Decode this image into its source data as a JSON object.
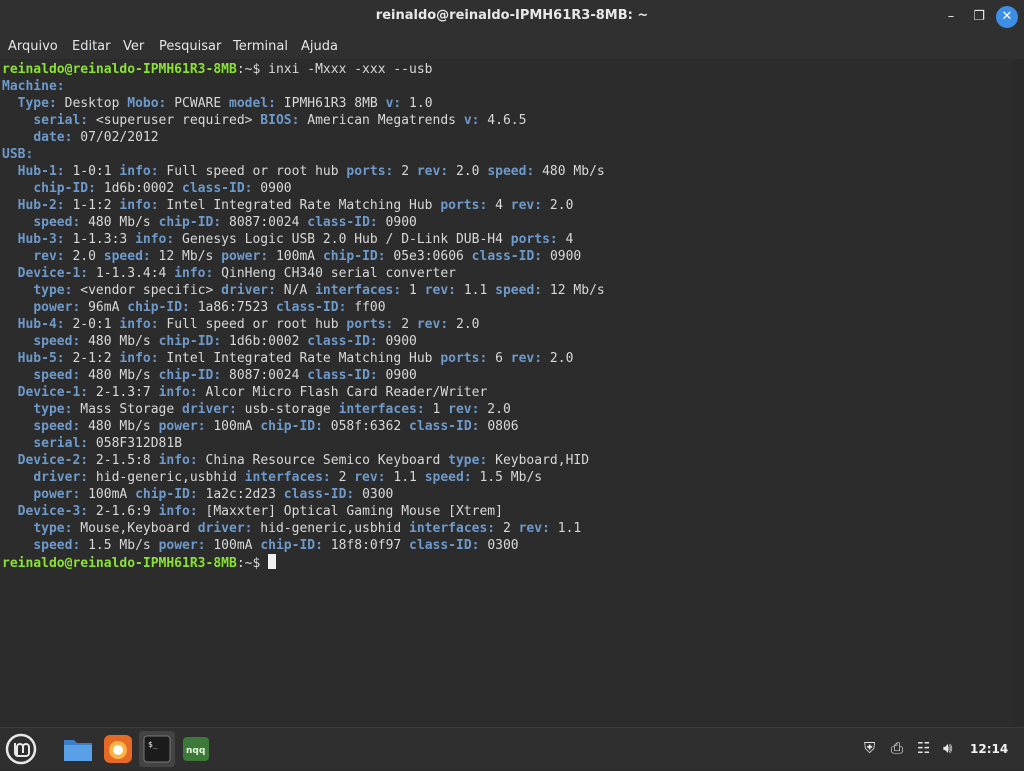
{
  "window": {
    "title": "reinaldo@reinaldo-IPMH61R3-8MB: ~",
    "minimize_icon": "minimize-icon",
    "maximize_icon": "maximize-icon",
    "close_icon": "close-icon"
  },
  "menu": [
    "Arquivo",
    "Editar",
    "Ver",
    "Pesquisar",
    "Terminal",
    "Ajuda"
  ],
  "terminal": {
    "prompt_user": "reinaldo@reinaldo-IPMH61R3-8MB",
    "prompt_suffix": ":~$",
    "command": "inxi -Mxxx -xxx --usb",
    "lines": [
      [
        [
          "k",
          "Machine:"
        ]
      ],
      [
        [
          "t",
          "  "
        ],
        [
          "k",
          "Type:"
        ],
        [
          "t",
          " Desktop "
        ],
        [
          "k",
          "Mobo:"
        ],
        [
          "t",
          " PCWARE "
        ],
        [
          "k",
          "model:"
        ],
        [
          "t",
          " IPMH61R3 8MB "
        ],
        [
          "k",
          "v:"
        ],
        [
          "t",
          " 1.0"
        ]
      ],
      [
        [
          "t",
          "    "
        ],
        [
          "k",
          "serial:"
        ],
        [
          "t",
          " <superuser required> "
        ],
        [
          "k",
          "BIOS:"
        ],
        [
          "t",
          " American Megatrends "
        ],
        [
          "k",
          "v:"
        ],
        [
          "t",
          " 4.6.5"
        ]
      ],
      [
        [
          "t",
          "    "
        ],
        [
          "k",
          "date:"
        ],
        [
          "t",
          " 07/02/2012"
        ]
      ],
      [
        [
          "k",
          "USB:"
        ]
      ],
      [
        [
          "t",
          "  "
        ],
        [
          "k",
          "Hub-1:"
        ],
        [
          "t",
          " 1-0:1 "
        ],
        [
          "k",
          "info:"
        ],
        [
          "t",
          " Full speed or root hub "
        ],
        [
          "k",
          "ports:"
        ],
        [
          "t",
          " 2 "
        ],
        [
          "k",
          "rev:"
        ],
        [
          "t",
          " 2.0 "
        ],
        [
          "k",
          "speed:"
        ],
        [
          "t",
          " 480 Mb/s"
        ]
      ],
      [
        [
          "t",
          "    "
        ],
        [
          "k",
          "chip-ID:"
        ],
        [
          "t",
          " 1d6b:0002 "
        ],
        [
          "k",
          "class-ID:"
        ],
        [
          "t",
          " 0900"
        ]
      ],
      [
        [
          "t",
          "  "
        ],
        [
          "k",
          "Hub-2:"
        ],
        [
          "t",
          " 1-1:2 "
        ],
        [
          "k",
          "info:"
        ],
        [
          "t",
          " Intel Integrated Rate Matching Hub "
        ],
        [
          "k",
          "ports:"
        ],
        [
          "t",
          " 4 "
        ],
        [
          "k",
          "rev:"
        ],
        [
          "t",
          " 2.0"
        ]
      ],
      [
        [
          "t",
          "    "
        ],
        [
          "k",
          "speed:"
        ],
        [
          "t",
          " 480 Mb/s "
        ],
        [
          "k",
          "chip-ID:"
        ],
        [
          "t",
          " 8087:0024 "
        ],
        [
          "k",
          "class-ID:"
        ],
        [
          "t",
          " 0900"
        ]
      ],
      [
        [
          "t",
          "  "
        ],
        [
          "k",
          "Hub-3:"
        ],
        [
          "t",
          " 1-1.3:3 "
        ],
        [
          "k",
          "info:"
        ],
        [
          "t",
          " Genesys Logic USB 2.0 Hub / D-Link DUB-H4 "
        ],
        [
          "k",
          "ports:"
        ],
        [
          "t",
          " 4"
        ]
      ],
      [
        [
          "t",
          "    "
        ],
        [
          "k",
          "rev:"
        ],
        [
          "t",
          " 2.0 "
        ],
        [
          "k",
          "speed:"
        ],
        [
          "t",
          " 12 Mb/s "
        ],
        [
          "k",
          "power:"
        ],
        [
          "t",
          " 100mA "
        ],
        [
          "k",
          "chip-ID:"
        ],
        [
          "t",
          " 05e3:0606 "
        ],
        [
          "k",
          "class-ID:"
        ],
        [
          "t",
          " 0900"
        ]
      ],
      [
        [
          "t",
          "  "
        ],
        [
          "k",
          "Device-1:"
        ],
        [
          "t",
          " 1-1.3.4:4 "
        ],
        [
          "k",
          "info:"
        ],
        [
          "t",
          " QinHeng CH340 serial converter"
        ]
      ],
      [
        [
          "t",
          "    "
        ],
        [
          "k",
          "type:"
        ],
        [
          "t",
          " <vendor specific> "
        ],
        [
          "k",
          "driver:"
        ],
        [
          "t",
          " N/A "
        ],
        [
          "k",
          "interfaces:"
        ],
        [
          "t",
          " 1 "
        ],
        [
          "k",
          "rev:"
        ],
        [
          "t",
          " 1.1 "
        ],
        [
          "k",
          "speed:"
        ],
        [
          "t",
          " 12 Mb/s"
        ]
      ],
      [
        [
          "t",
          "    "
        ],
        [
          "k",
          "power:"
        ],
        [
          "t",
          " 96mA "
        ],
        [
          "k",
          "chip-ID:"
        ],
        [
          "t",
          " 1a86:7523 "
        ],
        [
          "k",
          "class-ID:"
        ],
        [
          "t",
          " ff00"
        ]
      ],
      [
        [
          "t",
          "  "
        ],
        [
          "k",
          "Hub-4:"
        ],
        [
          "t",
          " 2-0:1 "
        ],
        [
          "k",
          "info:"
        ],
        [
          "t",
          " Full speed or root hub "
        ],
        [
          "k",
          "ports:"
        ],
        [
          "t",
          " 2 "
        ],
        [
          "k",
          "rev:"
        ],
        [
          "t",
          " 2.0"
        ]
      ],
      [
        [
          "t",
          "    "
        ],
        [
          "k",
          "speed:"
        ],
        [
          "t",
          " 480 Mb/s "
        ],
        [
          "k",
          "chip-ID:"
        ],
        [
          "t",
          " 1d6b:0002 "
        ],
        [
          "k",
          "class-ID:"
        ],
        [
          "t",
          " 0900"
        ]
      ],
      [
        [
          "t",
          "  "
        ],
        [
          "k",
          "Hub-5:"
        ],
        [
          "t",
          " 2-1:2 "
        ],
        [
          "k",
          "info:"
        ],
        [
          "t",
          " Intel Integrated Rate Matching Hub "
        ],
        [
          "k",
          "ports:"
        ],
        [
          "t",
          " 6 "
        ],
        [
          "k",
          "rev:"
        ],
        [
          "t",
          " 2.0"
        ]
      ],
      [
        [
          "t",
          "    "
        ],
        [
          "k",
          "speed:"
        ],
        [
          "t",
          " 480 Mb/s "
        ],
        [
          "k",
          "chip-ID:"
        ],
        [
          "t",
          " 8087:0024 "
        ],
        [
          "k",
          "class-ID:"
        ],
        [
          "t",
          " 0900"
        ]
      ],
      [
        [
          "t",
          "  "
        ],
        [
          "k",
          "Device-1:"
        ],
        [
          "t",
          " 2-1.3:7 "
        ],
        [
          "k",
          "info:"
        ],
        [
          "t",
          " Alcor Micro Flash Card Reader/Writer"
        ]
      ],
      [
        [
          "t",
          "    "
        ],
        [
          "k",
          "type:"
        ],
        [
          "t",
          " Mass Storage "
        ],
        [
          "k",
          "driver:"
        ],
        [
          "t",
          " usb-storage "
        ],
        [
          "k",
          "interfaces:"
        ],
        [
          "t",
          " 1 "
        ],
        [
          "k",
          "rev:"
        ],
        [
          "t",
          " 2.0"
        ]
      ],
      [
        [
          "t",
          "    "
        ],
        [
          "k",
          "speed:"
        ],
        [
          "t",
          " 480 Mb/s "
        ],
        [
          "k",
          "power:"
        ],
        [
          "t",
          " 100mA "
        ],
        [
          "k",
          "chip-ID:"
        ],
        [
          "t",
          " 058f:6362 "
        ],
        [
          "k",
          "class-ID:"
        ],
        [
          "t",
          " 0806"
        ]
      ],
      [
        [
          "t",
          "    "
        ],
        [
          "k",
          "serial:"
        ],
        [
          "t",
          " 058F312D81B"
        ]
      ],
      [
        [
          "t",
          "  "
        ],
        [
          "k",
          "Device-2:"
        ],
        [
          "t",
          " 2-1.5:8 "
        ],
        [
          "k",
          "info:"
        ],
        [
          "t",
          " China Resource Semico Keyboard "
        ],
        [
          "k",
          "type:"
        ],
        [
          "t",
          " Keyboard,HID"
        ]
      ],
      [
        [
          "t",
          "    "
        ],
        [
          "k",
          "driver:"
        ],
        [
          "t",
          " hid-generic,usbhid "
        ],
        [
          "k",
          "interfaces:"
        ],
        [
          "t",
          " 2 "
        ],
        [
          "k",
          "rev:"
        ],
        [
          "t",
          " 1.1 "
        ],
        [
          "k",
          "speed:"
        ],
        [
          "t",
          " 1.5 Mb/s"
        ]
      ],
      [
        [
          "t",
          "    "
        ],
        [
          "k",
          "power:"
        ],
        [
          "t",
          " 100mA "
        ],
        [
          "k",
          "chip-ID:"
        ],
        [
          "t",
          " 1a2c:2d23 "
        ],
        [
          "k",
          "class-ID:"
        ],
        [
          "t",
          " 0300"
        ]
      ],
      [
        [
          "t",
          "  "
        ],
        [
          "k",
          "Device-3:"
        ],
        [
          "t",
          " 2-1.6:9 "
        ],
        [
          "k",
          "info:"
        ],
        [
          "t",
          " [Maxxter] Optical Gaming Mouse [Xtrem]"
        ]
      ],
      [
        [
          "t",
          "    "
        ],
        [
          "k",
          "type:"
        ],
        [
          "t",
          " Mouse,Keyboard "
        ],
        [
          "k",
          "driver:"
        ],
        [
          "t",
          " hid-generic,usbhid "
        ],
        [
          "k",
          "interfaces:"
        ],
        [
          "t",
          " 2 "
        ],
        [
          "k",
          "rev:"
        ],
        [
          "t",
          " 1.1"
        ]
      ],
      [
        [
          "t",
          "    "
        ],
        [
          "k",
          "speed:"
        ],
        [
          "t",
          " 1.5 Mb/s "
        ],
        [
          "k",
          "power:"
        ],
        [
          "t",
          " 100mA "
        ],
        [
          "k",
          "chip-ID:"
        ],
        [
          "t",
          " 18f8:0f97 "
        ],
        [
          "k",
          "class-ID:"
        ],
        [
          "t",
          " 0300"
        ]
      ]
    ]
  },
  "taskbar": {
    "apps": [
      "mint-menu-icon",
      "file-manager-icon",
      "firefox-icon",
      "terminal-icon",
      "app-icon"
    ],
    "terminal_icon_text": "$_",
    "app_icon_text": "nqq",
    "tray": [
      "shield-icon",
      "printer-icon",
      "network-icon",
      "volume-icon"
    ],
    "clock": "12:14"
  }
}
